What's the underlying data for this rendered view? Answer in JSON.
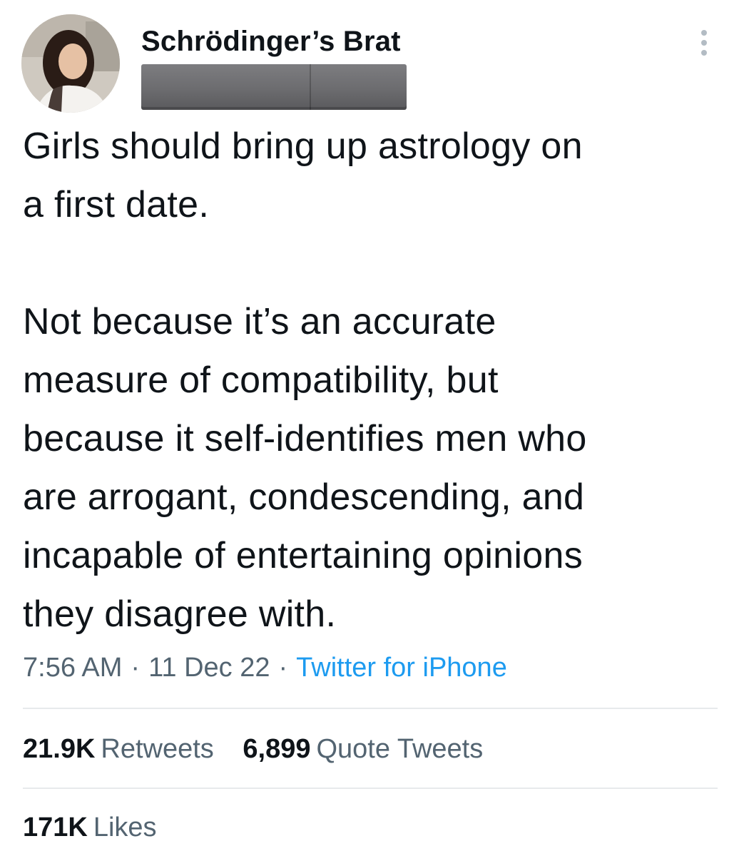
{
  "tweet": {
    "display_name": "Schrödinger’s Brat",
    "text_lines_para1": [
      "Girls should bring up astrology on",
      "a first date."
    ],
    "text_lines_para2": [
      "Not because it’s an accurate",
      "measure of compatibility, but",
      "because it self-identifies men who",
      "are arrogant, condescending, and",
      "incapable of entertaining opinions",
      "they disagree with."
    ],
    "time": "7:56 AM",
    "separator": "·",
    "date": "11 Dec 22",
    "source": "Twitter for iPhone"
  },
  "stats": {
    "retweets_count": "21.9K",
    "retweets_label": "Retweets",
    "quotes_count": "6,899",
    "quotes_label": "Quote Tweets",
    "likes_count": "171K",
    "likes_label": "Likes"
  },
  "colors": {
    "text": "#0f1419",
    "secondary": "#536471",
    "link": "#1d9bf0",
    "divider": "#e7eaec",
    "redaction": "#6c6c6f"
  },
  "icons": {
    "more": "more-vertical-icon",
    "avatar": "profile-photo"
  }
}
